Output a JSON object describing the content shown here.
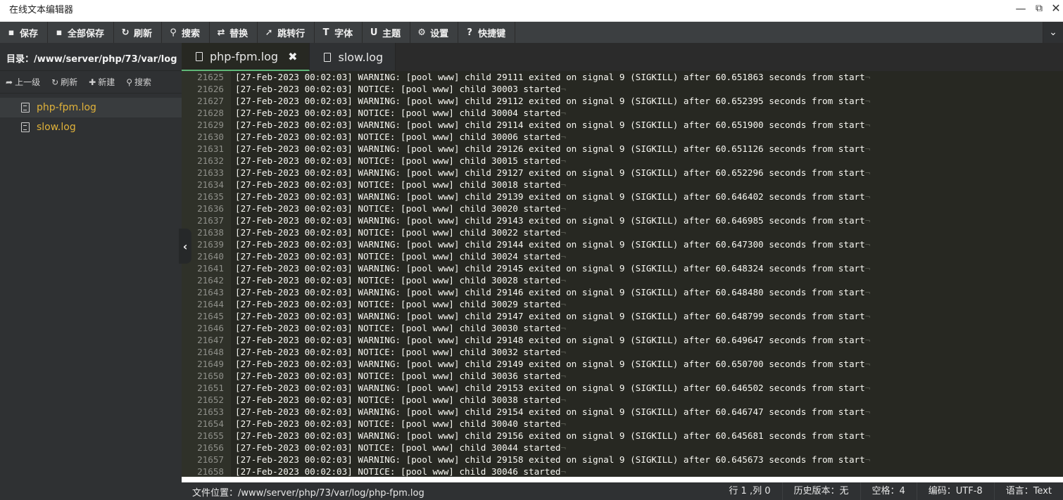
{
  "window": {
    "title": "在线文本编辑器",
    "min_icon": "minimize-icon",
    "max_icon": "maximize-icon",
    "close_icon": "close-icon"
  },
  "toolbar": [
    {
      "label": "保存",
      "icon": "save-icon",
      "glyph": "▪"
    },
    {
      "label": "全部保存",
      "icon": "save-all-icon",
      "glyph": "▪"
    },
    {
      "label": "刷新",
      "icon": "refresh-icon",
      "glyph": "↻"
    },
    {
      "label": "搜索",
      "icon": "search-icon",
      "glyph": "⚲"
    },
    {
      "label": "替换",
      "icon": "replace-icon",
      "glyph": "⇄"
    },
    {
      "label": "跳转行",
      "icon": "pin-icon",
      "glyph": "➚"
    },
    {
      "label": "字体",
      "icon": "text-icon",
      "glyph": "T"
    },
    {
      "label": "主题",
      "icon": "magnet-icon",
      "glyph": "U"
    },
    {
      "label": "设置",
      "icon": "gear-icon",
      "glyph": "⚙"
    },
    {
      "label": "快捷键",
      "icon": "help-icon",
      "glyph": "?"
    }
  ],
  "sidebar": {
    "directory_label": "目录：/www/server/php/73/var/log",
    "tools": [
      {
        "label": "上一级",
        "icon": "arrow-up-icon",
        "glyph": "➦"
      },
      {
        "label": "刷新",
        "icon": "refresh-icon",
        "glyph": "↻"
      },
      {
        "label": "新建",
        "icon": "plus-icon",
        "glyph": "✚"
      },
      {
        "label": "搜索",
        "icon": "search-icon",
        "glyph": "⚲"
      }
    ],
    "files": [
      {
        "name": "php-fpm.log",
        "active": true
      },
      {
        "name": "slow.log",
        "active": false
      }
    ]
  },
  "tabs": [
    {
      "label": "php-fpm.log",
      "active": true,
      "closable": true
    },
    {
      "label": "slow.log",
      "active": false,
      "closable": false
    }
  ],
  "editor": {
    "lines": [
      {
        "n": "21625",
        "t": "[27-Feb-2023 00:02:03] WARNING: [pool www] child 29111 exited on signal 9 (SIGKILL) after 60.651863 seconds from start"
      },
      {
        "n": "21626",
        "t": "[27-Feb-2023 00:02:03] NOTICE: [pool www] child 30003 started"
      },
      {
        "n": "21627",
        "t": "[27-Feb-2023 00:02:03] WARNING: [pool www] child 29112 exited on signal 9 (SIGKILL) after 60.652395 seconds from start"
      },
      {
        "n": "21628",
        "t": "[27-Feb-2023 00:02:03] NOTICE: [pool www] child 30004 started"
      },
      {
        "n": "21629",
        "t": "[27-Feb-2023 00:02:03] WARNING: [pool www] child 29114 exited on signal 9 (SIGKILL) after 60.651900 seconds from start"
      },
      {
        "n": "21630",
        "t": "[27-Feb-2023 00:02:03] NOTICE: [pool www] child 30006 started"
      },
      {
        "n": "21631",
        "t": "[27-Feb-2023 00:02:03] WARNING: [pool www] child 29126 exited on signal 9 (SIGKILL) after 60.651126 seconds from start"
      },
      {
        "n": "21632",
        "t": "[27-Feb-2023 00:02:03] NOTICE: [pool www] child 30015 started"
      },
      {
        "n": "21633",
        "t": "[27-Feb-2023 00:02:03] WARNING: [pool www] child 29127 exited on signal 9 (SIGKILL) after 60.652296 seconds from start"
      },
      {
        "n": "21634",
        "t": "[27-Feb-2023 00:02:03] NOTICE: [pool www] child 30018 started"
      },
      {
        "n": "21635",
        "t": "[27-Feb-2023 00:02:03] WARNING: [pool www] child 29139 exited on signal 9 (SIGKILL) after 60.646402 seconds from start"
      },
      {
        "n": "21636",
        "t": "[27-Feb-2023 00:02:03] NOTICE: [pool www] child 30020 started"
      },
      {
        "n": "21637",
        "t": "[27-Feb-2023 00:02:03] WARNING: [pool www] child 29143 exited on signal 9 (SIGKILL) after 60.646985 seconds from start"
      },
      {
        "n": "21638",
        "t": "[27-Feb-2023 00:02:03] NOTICE: [pool www] child 30022 started"
      },
      {
        "n": "21639",
        "t": "[27-Feb-2023 00:02:03] WARNING: [pool www] child 29144 exited on signal 9 (SIGKILL) after 60.647300 seconds from start"
      },
      {
        "n": "21640",
        "t": "[27-Feb-2023 00:02:03] NOTICE: [pool www] child 30024 started"
      },
      {
        "n": "21641",
        "t": "[27-Feb-2023 00:02:03] WARNING: [pool www] child 29145 exited on signal 9 (SIGKILL) after 60.648324 seconds from start"
      },
      {
        "n": "21642",
        "t": "[27-Feb-2023 00:02:03] NOTICE: [pool www] child 30028 started"
      },
      {
        "n": "21643",
        "t": "[27-Feb-2023 00:02:03] WARNING: [pool www] child 29146 exited on signal 9 (SIGKILL) after 60.648480 seconds from start"
      },
      {
        "n": "21644",
        "t": "[27-Feb-2023 00:02:03] NOTICE: [pool www] child 30029 started"
      },
      {
        "n": "21645",
        "t": "[27-Feb-2023 00:02:03] WARNING: [pool www] child 29147 exited on signal 9 (SIGKILL) after 60.648799 seconds from start"
      },
      {
        "n": "21646",
        "t": "[27-Feb-2023 00:02:03] NOTICE: [pool www] child 30030 started"
      },
      {
        "n": "21647",
        "t": "[27-Feb-2023 00:02:03] WARNING: [pool www] child 29148 exited on signal 9 (SIGKILL) after 60.649647 seconds from start"
      },
      {
        "n": "21648",
        "t": "[27-Feb-2023 00:02:03] NOTICE: [pool www] child 30032 started"
      },
      {
        "n": "21649",
        "t": "[27-Feb-2023 00:02:03] WARNING: [pool www] child 29149 exited on signal 9 (SIGKILL) after 60.650700 seconds from start"
      },
      {
        "n": "21650",
        "t": "[27-Feb-2023 00:02:03] NOTICE: [pool www] child 30036 started"
      },
      {
        "n": "21651",
        "t": "[27-Feb-2023 00:02:03] WARNING: [pool www] child 29153 exited on signal 9 (SIGKILL) after 60.646502 seconds from start"
      },
      {
        "n": "21652",
        "t": "[27-Feb-2023 00:02:03] NOTICE: [pool www] child 30038 started"
      },
      {
        "n": "21653",
        "t": "[27-Feb-2023 00:02:03] WARNING: [pool www] child 29154 exited on signal 9 (SIGKILL) after 60.646747 seconds from start"
      },
      {
        "n": "21654",
        "t": "[27-Feb-2023 00:02:03] NOTICE: [pool www] child 30040 started"
      },
      {
        "n": "21655",
        "t": "[27-Feb-2023 00:02:03] WARNING: [pool www] child 29156 exited on signal 9 (SIGKILL) after 60.645681 seconds from start"
      },
      {
        "n": "21656",
        "t": "[27-Feb-2023 00:02:03] NOTICE: [pool www] child 30044 started"
      },
      {
        "n": "21657",
        "t": "[27-Feb-2023 00:02:03] WARNING: [pool www] child 29158 exited on signal 9 (SIGKILL) after 60.645673 seconds from start"
      },
      {
        "n": "21658",
        "t": "[27-Feb-2023 00:02:03] NOTICE: [pool www] child 30046 started"
      }
    ]
  },
  "statusbar": {
    "file_path": "文件位置：/www/server/php/73/var/log/php-fpm.log",
    "cursor": "行 1 ,列 0",
    "history": "历史版本：无",
    "indent": "空格：4",
    "encoding": "编码：UTF-8",
    "language": "语言：Text"
  },
  "colors": {
    "toolbar_bg": "#3c3f41",
    "sidebar_bg": "#2f3133",
    "editor_bg": "#272822",
    "file_link": "#e0b23a",
    "active_tab_accent": "#5fb878"
  }
}
